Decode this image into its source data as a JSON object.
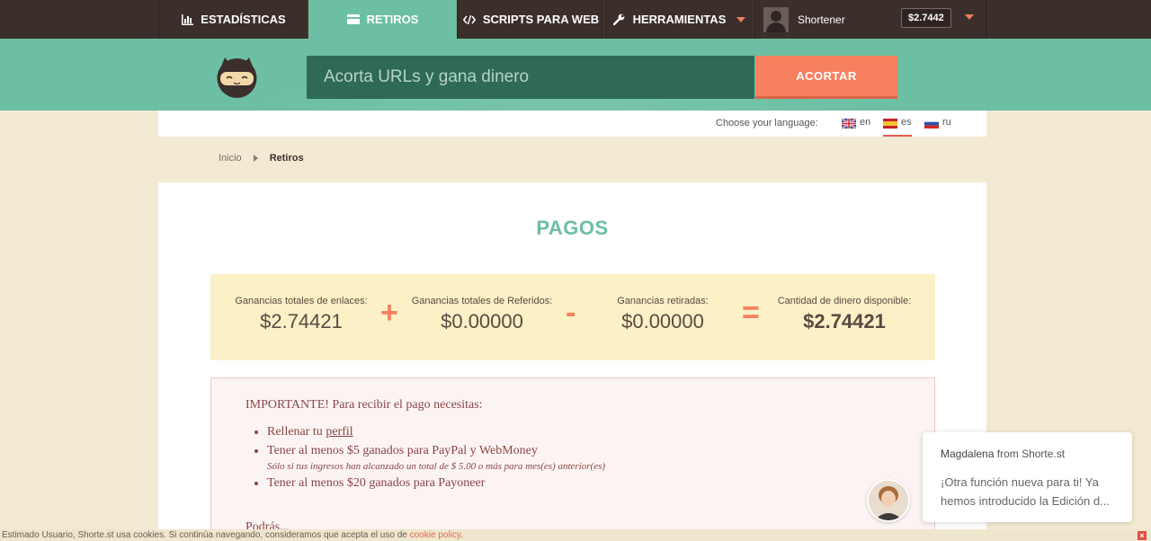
{
  "nav": {
    "items": [
      {
        "label": "ESTADÍSTICAS",
        "icon": "bar-chart-icon"
      },
      {
        "label": "RETIROS",
        "icon": "payment-card-icon"
      },
      {
        "label": "SCRIPTS PARA WEB",
        "icon": "code-icon"
      },
      {
        "label": "HERRAMIENTAS",
        "icon": "wrench-icon"
      }
    ],
    "username": "Shortener",
    "balance": "$2.7442"
  },
  "header": {
    "url_placeholder": "Acorta URLs y gana dinero",
    "shorten_label": "ACORTAR"
  },
  "language": {
    "label": "Choose your language:",
    "options": [
      {
        "code": "en",
        "flag": "uk-flag-icon"
      },
      {
        "code": "es",
        "flag": "spain-flag-icon",
        "active": true
      },
      {
        "code": "ru",
        "flag": "russia-flag-icon"
      }
    ]
  },
  "breadcrumb": {
    "home": "Inicio",
    "current": "Retiros"
  },
  "main": {
    "title": "PAGOS",
    "stats": [
      {
        "label": "Ganancias totales de enlaces:",
        "value": "$2.74421"
      },
      {
        "label": "Ganancias totales de Referidos:",
        "value": "$0.00000"
      },
      {
        "label": "Ganancias retiradas:",
        "value": "$0.00000"
      },
      {
        "label": "Cantidad de dinero disponible:",
        "value": "$2.74421"
      }
    ],
    "operators": [
      "+",
      "-",
      "="
    ],
    "notice": {
      "title": "IMPORTANTE! Para recibir el pago necesitas:",
      "item1_prefix": "Rellenar tu ",
      "item1_link": "perfil",
      "item2": "Tener al menos $5 ganados para PayPal y WebMoney",
      "item2_sub": "Sólo si tus ingresos han alcanzado un total de $ 5.00 o más para mes(es) anterior(es)",
      "item3": "Tener al menos $20 ganados para Payoneer",
      "extra": "Podrás..."
    }
  },
  "chat": {
    "name": "Magdalena",
    "from": "from Shorte.st",
    "message": "¡Otra función nueva para ti! Ya hemos introducido la Edición d..."
  },
  "cookie": {
    "text": "Estimado Usuario, Shorte.st usa cookies. Si continúa navegando, consideramos que acepta el uso de ",
    "link": "cookie policy",
    "suffix": ".",
    "close": "×"
  },
  "colors": {
    "accent": "#6cbfa2",
    "orange": "#f7805f",
    "dark": "#3b2f2b"
  }
}
